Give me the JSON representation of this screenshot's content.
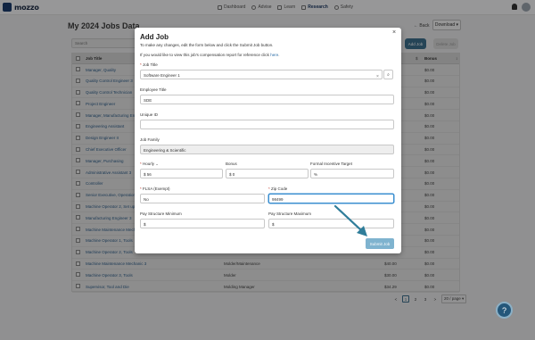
{
  "app": {
    "logo_text": "mozzo"
  },
  "nav": {
    "items": [
      {
        "label": "Dashboard",
        "icon": "dashboard-icon"
      },
      {
        "label": "Advise",
        "icon": "advise-icon"
      },
      {
        "label": "Learn",
        "icon": "book-icon"
      },
      {
        "label": "Research",
        "icon": "research-icon"
      },
      {
        "label": "Safety",
        "icon": "safety-icon"
      }
    ],
    "active": "Research"
  },
  "page": {
    "title": "My 2024 Jobs Data",
    "back_label": "← Back",
    "download_label": "Download ▾",
    "search_placeholder": "Search",
    "add_job_label": "Add Job",
    "delete_job_label": "Delete Job"
  },
  "table": {
    "headers": {
      "title": "Job Title",
      "bonus": "Bonus",
      "dollar": "$",
      "sort": "↕"
    },
    "rows": [
      {
        "title": "Manager, Quality",
        "family": "",
        "amount": "",
        "bonus": "$0.00"
      },
      {
        "title": "Quality Control Engineer 3",
        "family": "",
        "amount": "",
        "bonus": "$0.00"
      },
      {
        "title": "Quality Control Technician",
        "family": "",
        "amount": "",
        "bonus": "$0.00"
      },
      {
        "title": "Project Engineer",
        "family": "",
        "amount": "",
        "bonus": "$0.00"
      },
      {
        "title": "Manager, Manufacturing En",
        "family": "",
        "amount": "",
        "bonus": "$0.00"
      },
      {
        "title": "Engineering Assistant",
        "family": "",
        "amount": "",
        "bonus": "$0.00"
      },
      {
        "title": "Design Engineer II",
        "family": "",
        "amount": "",
        "bonus": "$0.00"
      },
      {
        "title": "Chief Executive Officer",
        "family": "",
        "amount": "",
        "bonus": "$0.00"
      },
      {
        "title": "Manager, Purchasing",
        "family": "",
        "amount": "",
        "bonus": "$0.00"
      },
      {
        "title": "Administrative Assistant 3",
        "family": "",
        "amount": "",
        "bonus": "$0.00"
      },
      {
        "title": "Controller",
        "family": "",
        "amount": "",
        "bonus": "$0.00"
      },
      {
        "title": "Senior Executive, Operation",
        "family": "",
        "amount": "",
        "bonus": "$0.00"
      },
      {
        "title": "Machine Operator 2, Set up",
        "family": "",
        "amount": "",
        "bonus": "$0.00"
      },
      {
        "title": "Manufacturing Engineer 3",
        "family": "",
        "amount": "",
        "bonus": "$0.00"
      },
      {
        "title": "Machine Maintenance Mech",
        "family": "",
        "amount": "",
        "bonus": "$0.00"
      },
      {
        "title": "Machine Operator 1, Tools",
        "family": "",
        "amount": "",
        "bonus": "$0.00"
      },
      {
        "title": "Machine Operator 2, Tools",
        "family": "",
        "amount": "",
        "bonus": "$0.00"
      },
      {
        "title": "Machine Maintenance Mechanic 3",
        "family": "Molder/Maintenance",
        "amount": "$40.00",
        "bonus": "$0.00"
      },
      {
        "title": "Machine Operator 3, Tools",
        "family": "Molder",
        "amount": "$30.00",
        "bonus": "$0.00"
      },
      {
        "title": "Supervisor, Tool and Die",
        "family": "Molding Manager",
        "amount": "$34.29",
        "bonus": "$0.00"
      }
    ]
  },
  "pager": {
    "prev": "<",
    "pages": [
      "1",
      "2",
      "3"
    ],
    "active_page": "1",
    "next": ">",
    "page_size": "20 / page ▾"
  },
  "modal": {
    "title": "Add Job",
    "close": "×",
    "intro": "To make any changes, edit the form below and click the Submit Job button.",
    "compensation_prefix": "If you would like to view this job's compensation report for reference click ",
    "compensation_link": "here",
    "compensation_suffix": ".",
    "fields": {
      "job_title": {
        "label": "Job Title",
        "value": "Software Engineer 1"
      },
      "employee_title": {
        "label": "Employee Title",
        "value": "SDE"
      },
      "unique_id": {
        "label": "Unique ID",
        "value": ""
      },
      "job_family": {
        "label": "Job Family",
        "value": "Engineering & Scientific"
      },
      "pay_type": {
        "label": "Hourly",
        "value": "$ 56"
      },
      "bonus": {
        "label": "Bonus",
        "value": "$ 0"
      },
      "formal_incentive": {
        "label": "Formal Incentive Target",
        "value": "%"
      },
      "flsa": {
        "label": "FLSA (Exempt)",
        "value": "No"
      },
      "zip": {
        "label": "Zip Code",
        "value": "98499"
      },
      "pay_min": {
        "label": "Pay Structure Minimum",
        "value": "$"
      },
      "pay_max": {
        "label": "Pay Structure Maximum",
        "value": "$"
      }
    },
    "required_mark": "*",
    "submit_label": "Submit Job",
    "clear_glyph": "×",
    "search_glyph": "⌕",
    "chevron_glyph": "⌄"
  },
  "help": {
    "glyph": "?"
  },
  "colors": {
    "primary": "#3d6f8c",
    "annotation_arrow": "#2f7d9a",
    "submit_disabled": "#7fb3cf"
  }
}
